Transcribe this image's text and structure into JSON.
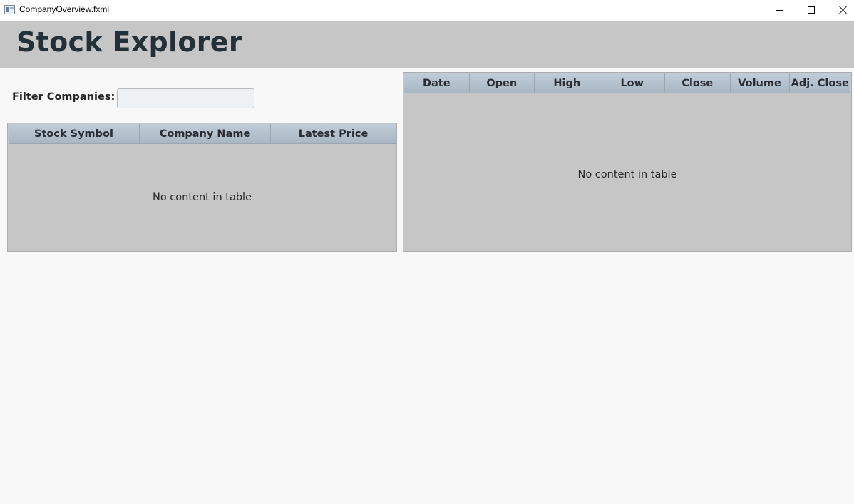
{
  "window": {
    "title": "CompanyOverview.fxml",
    "icon": "java-app-icon",
    "controls": [
      "minimize-icon",
      "maximize-icon",
      "close-icon"
    ]
  },
  "header": {
    "title": "Stock Explorer"
  },
  "filter": {
    "label": "Filter Companies:",
    "value": "",
    "placeholder": ""
  },
  "companies_table": {
    "columns": [
      "Stock Symbol",
      "Company Name",
      "Latest Price"
    ],
    "rows": [],
    "empty_text": "No content in table"
  },
  "history_table": {
    "columns": [
      "Date",
      "Open",
      "High",
      "Low",
      "Close",
      "Volume",
      "Adj. Close"
    ],
    "rows": [],
    "empty_text": "No content in table"
  },
  "colors": {
    "header_bg": "#c6c6c6",
    "title_text": "#243037",
    "table_header": "#b3c0cc",
    "table_body": "#c6c6c6",
    "window_bg": "#f8f8f8"
  }
}
